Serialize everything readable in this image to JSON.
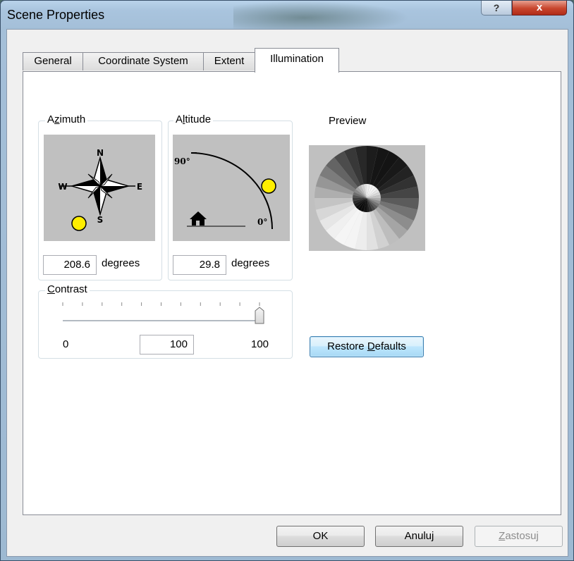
{
  "window": {
    "title": "Scene Properties",
    "help_glyph": "?",
    "close_glyph": "x"
  },
  "tabs": [
    {
      "label": "General",
      "active": false
    },
    {
      "label": "Coordinate System",
      "active": false
    },
    {
      "label": "Extent",
      "active": false
    },
    {
      "label": "Illumination",
      "active": true
    }
  ],
  "azimuth": {
    "label_pre": "A",
    "label_ul": "z",
    "label_post": "imuth",
    "compass": {
      "n": "N",
      "e": "E",
      "s": "S",
      "w": "W"
    },
    "value": "208.6",
    "unit": "degrees"
  },
  "altitude": {
    "label_pre": "A",
    "label_ul": "l",
    "label_post": "titude",
    "top_mark": "90°",
    "bottom_mark": "0°",
    "value": "29.8",
    "unit": "degrees"
  },
  "preview": {
    "label": "Preview"
  },
  "contrast": {
    "label_ul": "C",
    "label_post": "ontrast",
    "min": "0",
    "max": "100",
    "value": "100"
  },
  "buttons": {
    "restore_pre": "Restore ",
    "restore_ul": "D",
    "restore_post": "efaults",
    "ok": "OK",
    "cancel": "Anuluj",
    "apply_ul": "Z",
    "apply_post": "astosuj"
  },
  "colors": {
    "sun": "#ffee00",
    "canvas_bg": "#c0c0c0"
  }
}
